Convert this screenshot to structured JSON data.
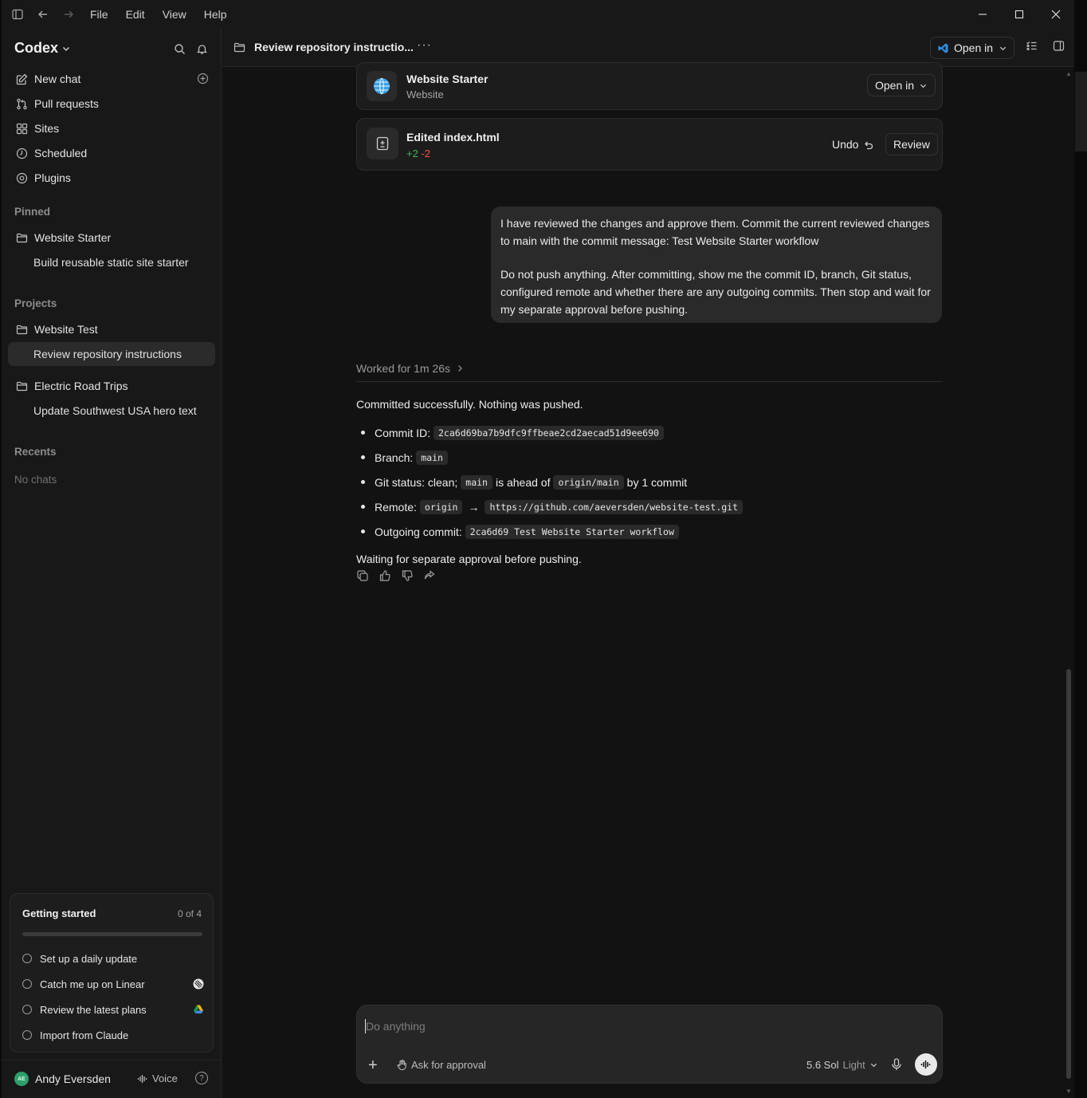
{
  "menu": {
    "file": "File",
    "edit": "Edit",
    "view": "View",
    "help": "Help"
  },
  "sidebar": {
    "brand": "Codex",
    "nav": [
      {
        "label": "New chat"
      },
      {
        "label": "Pull requests"
      },
      {
        "label": "Sites"
      },
      {
        "label": "Scheduled"
      },
      {
        "label": "Plugins"
      }
    ],
    "pinned_label": "Pinned",
    "pinned_project": "Website Starter",
    "pinned_thread": "Build reusable static site starter",
    "projects_label": "Projects",
    "project1": "Website Test",
    "project1_thread": "Review repository instructions",
    "project2": "Electric Road Trips",
    "project2_thread": "Update Southwest USA hero text",
    "recents_label": "Recents",
    "recents_empty": "No chats"
  },
  "getting_started": {
    "title": "Getting started",
    "count": "0 of 4",
    "progress": 0,
    "items": [
      "Set up a daily update",
      "Catch me up on Linear",
      "Review the latest plans",
      "Import from Claude"
    ]
  },
  "footer": {
    "initials": "AE",
    "user": "Andy Eversden",
    "voice": "Voice",
    "help": "?"
  },
  "header": {
    "title": "Review repository instructio...",
    "open_in": "Open in"
  },
  "cards": {
    "site_title": "Website Starter",
    "site_sub": "Website",
    "site_button": "Open in",
    "edit_title": "Edited index.html",
    "additions": "+2",
    "deletions": "-2",
    "undo": "Undo",
    "review": "Review"
  },
  "user_message": {
    "p1": "I have reviewed the changes and approve them. Commit the current reviewed changes to main with the commit message: Test Website Starter workflow",
    "p2": "Do not push anything. After committing, show me the commit ID, branch, Git status, configured remote and whether there are any outgoing commits. Then stop and wait for my separate approval before pushing."
  },
  "assistant": {
    "worked": "Worked for 1m 26s",
    "intro": "Committed successfully. Nothing was pushed.",
    "commit_label": "Commit ID:",
    "commit_id": "2ca6d69ba7b9dfc9ffbeae2cd2aecad51d9ee690",
    "branch_label": "Branch:",
    "branch": "main",
    "status_label": "Git status: clean;",
    "status_branch": "main",
    "status_mid": "is ahead of",
    "status_upstream": "origin/main",
    "status_tail": "by 1 commit",
    "remote_label": "Remote:",
    "remote_name": "origin",
    "remote_arrow": "→",
    "remote_url": "https://github.com/aeversden/website-test.git",
    "outgoing_label": "Outgoing commit:",
    "outgoing": "2ca6d69 Test Website Starter workflow",
    "closing": "Waiting for separate approval before pushing."
  },
  "composer": {
    "placeholder": "Do anything",
    "approval": "Ask for approval",
    "model": "5.6 Sol",
    "model_variant": "Light"
  }
}
